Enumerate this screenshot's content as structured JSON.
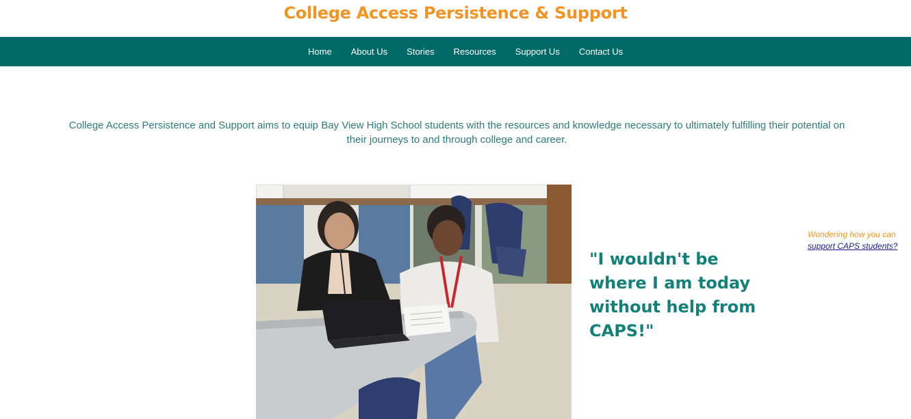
{
  "header": {
    "title": "College Access Persistence & Support"
  },
  "nav": {
    "items": [
      {
        "label": "Home"
      },
      {
        "label": "About Us"
      },
      {
        "label": "Stories"
      },
      {
        "label": "Resources"
      },
      {
        "label": "Support Us"
      },
      {
        "label": "Contact Us"
      }
    ]
  },
  "main": {
    "mission": "College Access Persistence and Support aims to equip Bay View High School students with the resources and knowledge necessary to ultimately fulfilling their potential on their journeys to and through college and career.",
    "quote": "\"I wouldn't be where I am today without help from CAPS!\"",
    "side_note": {
      "lead": "Wondering how you can",
      "link": "support CAPS students?"
    }
  },
  "colors": {
    "brand_orange": "#f39322",
    "nav_teal": "#006a66",
    "quote_teal": "#13807a",
    "link_blue": "#1a1a8c"
  }
}
